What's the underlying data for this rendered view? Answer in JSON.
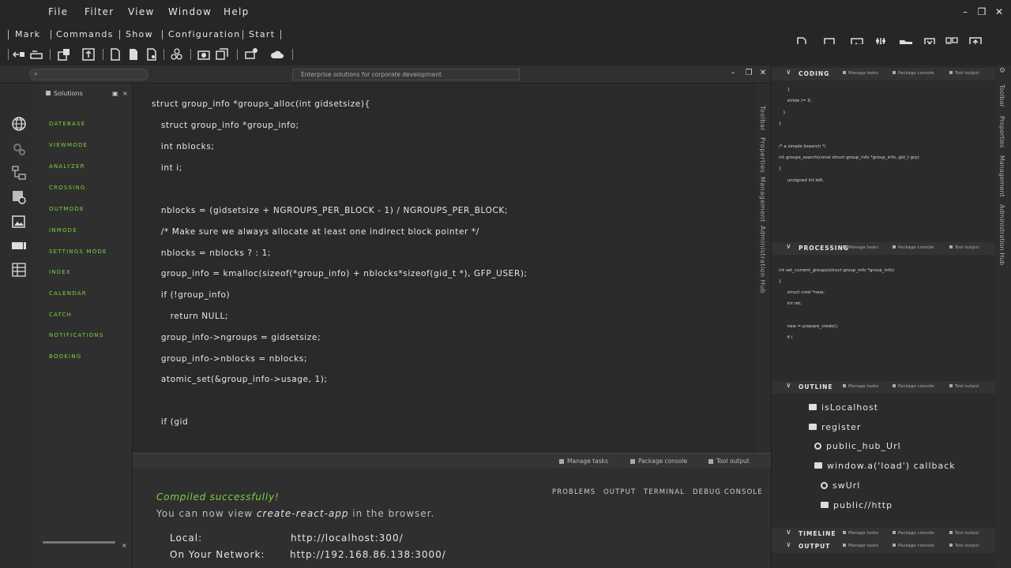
{
  "menubar": {
    "items": [
      "File",
      "Filter",
      "View",
      "Window",
      "Help"
    ],
    "minimize": "–",
    "restore": "❐",
    "close": "✕"
  },
  "menubar2": {
    "items": [
      "Mark",
      "Commands",
      "Show",
      "Configuration",
      "Start"
    ]
  },
  "search": {
    "placeholder": ""
  },
  "strip": {
    "title": "Enterprise solutions for corporate development",
    "minimize": "–",
    "restore": "❐",
    "close": "✕"
  },
  "solutions": {
    "title": "Solutions",
    "items": [
      "DATEBASE",
      "VIEWMODE",
      "ANALYZER",
      "CROSSING",
      "OUTMODE",
      "INMODE",
      "SETTINGS MODE",
      "INDEX",
      "CALENDAR",
      "CATCH",
      "NOTIFICATIONS",
      "BOOKING"
    ]
  },
  "code": [
    "struct group_info *groups_alloc(int gidsetsize){",
    "   struct group_info *group_info;",
    "   int nblocks;",
    "   int i;",
    "",
    "   nblocks = (gidsetsize + NGROUPS_PER_BLOCK - 1) / NGROUPS_PER_BLOCK;",
    "   /* Make sure we always allocate at least one indirect block pointer */",
    "   nblocks = nblocks ? : 1;",
    "   group_info = kmalloc(sizeof(*group_info) + nblocks*sizeof(gid_t *), GFP_USER);",
    "   if (!group_info)",
    "      return NULL;",
    "   group_info->ngroups = gidsetsize;",
    "   group_info->nblocks = nblocks;",
    "   atomic_set(&group_info->usage, 1);",
    "",
    "   if (gid"
  ],
  "editor_vtabs": [
    "Toolbar",
    "Properties",
    "Management",
    "Administration Hub"
  ],
  "bottom": {
    "tabs": [
      "Manage tasks",
      "Package console",
      "Tool output"
    ],
    "terminal_tabs": [
      "PROBLEMS",
      "OUTPUT",
      "TERMINAL",
      "DEBUG CONSOLE"
    ],
    "compiled": "Compiled successfully!",
    "view_pre": "You can now view ",
    "view_app": "create-react-app",
    "view_post": " in the browser.",
    "local_label": "Local:",
    "local_url": "http://localhost:300/",
    "network_label": "On Your Network:",
    "network_url": "http://192.168.86.138:3000/"
  },
  "panels": {
    "sub_tabs": [
      "Manage tasks",
      "Package console",
      "Tool output"
    ],
    "coding": {
      "title": "CODING",
      "lines": [
        "      }",
        "      stride /= 3;",
        "   }",
        "}",
        "",
        "",
        "/* a simple bsearch */",
        "int groups_search(const struct group_info *group_info, gid_t grp)",
        "{",
        "      unsigned int left,"
      ]
    },
    "processing": {
      "title": "PROCESSING",
      "lines": [
        "int set_current_groups(struct group_info *group_info)",
        "{",
        "      struct cred *new;",
        "      int ret;",
        "",
        "",
        "      new = prepare_creds();",
        "      if ("
      ]
    },
    "outline": {
      "title": "OUTLINE",
      "items": [
        "isLocalhost",
        "register",
        "public_hub_Url",
        "window.a('load') callback",
        "swUrl",
        "public//http"
      ]
    },
    "timeline": {
      "title": "TIMELINE"
    },
    "output": {
      "title": "OUTPUT"
    }
  },
  "right_vtabs": [
    "Toolbar",
    "Properties",
    "Management",
    "Administration Hub"
  ]
}
